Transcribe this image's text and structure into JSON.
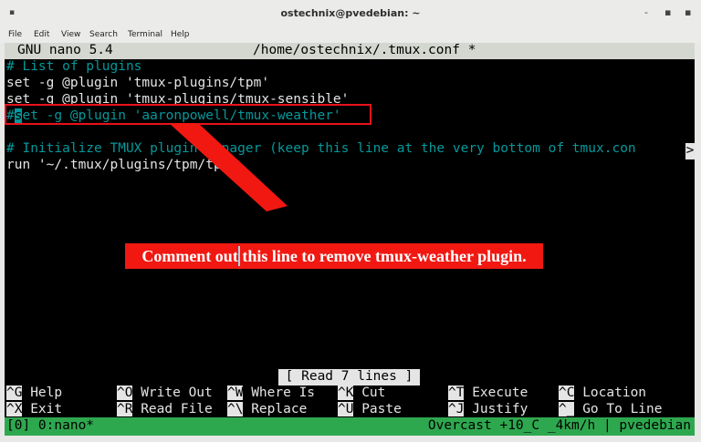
{
  "window": {
    "title": "ostechnix@pvedebian: ~",
    "minimize": "-",
    "maximize": "▪",
    "close": "▪"
  },
  "menu": [
    "File",
    "Edit",
    "View",
    "Search",
    "Terminal",
    "Help"
  ],
  "nano": {
    "version": "GNU nano 5.4",
    "filename": "/home/ostechnix/.tmux.conf *"
  },
  "lines": {
    "l1": "# List of plugins",
    "l2": "set -g @plugin 'tmux-plugins/tpm'",
    "l3": "set -g @plugin 'tmux-plugins/tmux-sensible'",
    "l4_hash": "#",
    "l4_cursor": "s",
    "l4_rest": "et -g @plugin 'aaronpowell/tmux-weather'",
    "l6": "# Initialize TMUX plugin manager (keep this line at the very bottom of tmux.con",
    "l6_more": ">",
    "l7": "run '~/.tmux/plugins/tpm/tpm'"
  },
  "annotation": {
    "part1": "Comment out ",
    "part2": "this line to remove tmux-weather plugin."
  },
  "status_message": "[ Read 7 lines ]",
  "shortcuts": [
    {
      "key": "^G",
      "label": "Help"
    },
    {
      "key": "^O",
      "label": "Write Out"
    },
    {
      "key": "^W",
      "label": "Where Is"
    },
    {
      "key": "^K",
      "label": "Cut"
    },
    {
      "key": "^T",
      "label": "Execute"
    },
    {
      "key": "^C",
      "label": "Location"
    },
    {
      "key": "^X",
      "label": "Exit"
    },
    {
      "key": "^R",
      "label": "Read File"
    },
    {
      "key": "^\\",
      "label": "Replace"
    },
    {
      "key": "^U",
      "label": "Paste"
    },
    {
      "key": "^J",
      "label": "Justify"
    },
    {
      "key": "^_",
      "label": "Go To Line"
    }
  ],
  "tmux": {
    "left": "[0] 0:nano*",
    "right": "Overcast +10_C _4km/h | pvedebian"
  },
  "colors": {
    "terminal_bg": "#000000",
    "comment": "#06989a",
    "annotation": "#f11812",
    "tmux_bar": "#2ea84f"
  }
}
